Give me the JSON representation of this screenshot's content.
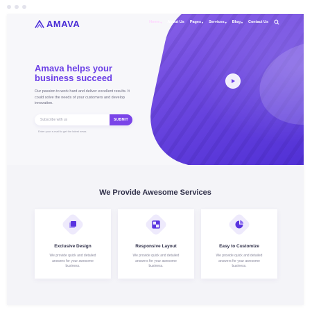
{
  "brand": {
    "name": "AMAVA",
    "accent": "#6a3ee6",
    "gradient_start": "#8a63e8",
    "gradient_end": "#4d2dd4"
  },
  "nav": {
    "items": [
      {
        "label": "Home",
        "caret": true,
        "active": true
      },
      {
        "label": "About Us",
        "caret": false
      },
      {
        "label": "Pages",
        "caret": true
      },
      {
        "label": "Services",
        "caret": true
      },
      {
        "label": "Blog",
        "caret": true
      },
      {
        "label": "Contact Us",
        "caret": false
      }
    ],
    "search_icon": "search-icon"
  },
  "hero": {
    "headline": "Amava helps your business succeed",
    "lead": "Our passion to work hard and deliver excellent results. It could solve the needs of your customers and develop innovation.",
    "subscribe": {
      "placeholder": "Subscribe with us",
      "button": "SUBMIT",
      "note": "Enter your e-mail to get the latest news."
    },
    "play_icon": "play-icon"
  },
  "services": {
    "title": "We Provide Awesome Services",
    "cards": [
      {
        "icon": "layers-icon",
        "title": "Exclusive Design",
        "text": "We provide quick and detailed answers for your awesome business."
      },
      {
        "icon": "grid-icon",
        "title": "Responsive Layout",
        "text": "We provide quick and detailed answers for your awesome business."
      },
      {
        "icon": "pie-chart-icon",
        "title": "Easy to Customize",
        "text": "We provide quick and detailed answers for your awesome business."
      }
    ]
  }
}
